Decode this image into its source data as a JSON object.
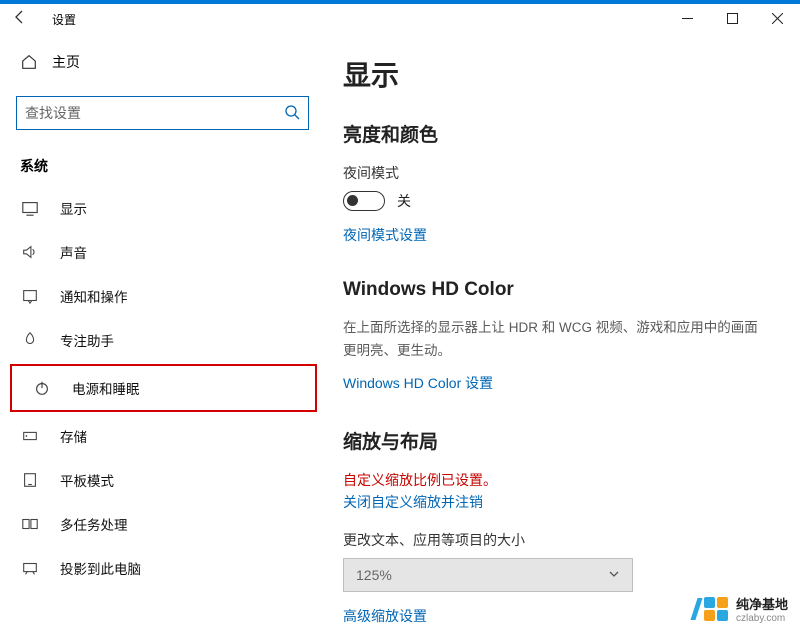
{
  "titlebar": {
    "title": "设置"
  },
  "sidebar": {
    "home": "主页",
    "search_placeholder": "查找设置",
    "group": "系统",
    "items": [
      {
        "label": "显示"
      },
      {
        "label": "声音"
      },
      {
        "label": "通知和操作"
      },
      {
        "label": "专注助手"
      },
      {
        "label": "电源和睡眠"
      },
      {
        "label": "存储"
      },
      {
        "label": "平板模式"
      },
      {
        "label": "多任务处理"
      },
      {
        "label": "投影到此电脑"
      }
    ]
  },
  "content": {
    "page_title": "显示",
    "brightness": {
      "heading": "亮度和颜色",
      "night_label": "夜间模式",
      "toggle_state": "关",
      "night_link": "夜间模式设置"
    },
    "hd": {
      "heading": "Windows HD Color",
      "desc": "在上面所选择的显示器上让 HDR 和 WCG 视频、游戏和应用中的画面更明亮、更生动。",
      "link": "Windows HD Color 设置"
    },
    "scale": {
      "heading": "缩放与布局",
      "warning": "自定义缩放比例已设置。",
      "logout_link": "关闭自定义缩放并注销",
      "size_label": "更改文本、应用等项目的大小",
      "dropdown_value": "125%",
      "advanced_link": "高级缩放设置"
    }
  },
  "watermark": {
    "brand": "纯净基地",
    "url": "czlaby.com"
  }
}
